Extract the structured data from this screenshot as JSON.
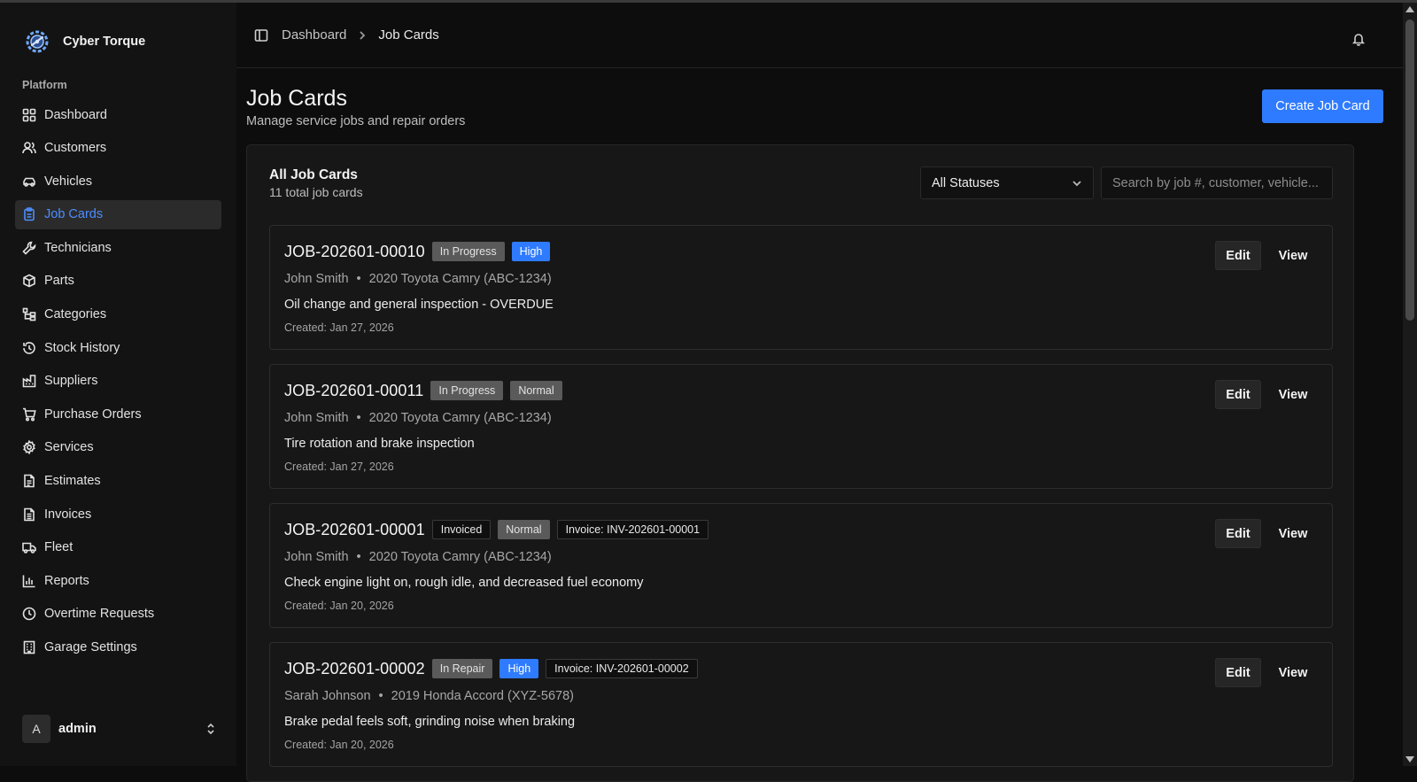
{
  "brand": {
    "name": "Cyber Torque",
    "logo_icon": "gear-logo-icon"
  },
  "sidebar": {
    "section_label": "Platform",
    "items": [
      {
        "label": "Dashboard",
        "icon": "grid-icon",
        "active": false
      },
      {
        "label": "Customers",
        "icon": "users-icon",
        "active": false
      },
      {
        "label": "Vehicles",
        "icon": "car-icon",
        "active": false
      },
      {
        "label": "Job Cards",
        "icon": "clipboard-icon",
        "active": true
      },
      {
        "label": "Technicians",
        "icon": "wrench-icon",
        "active": false
      },
      {
        "label": "Parts",
        "icon": "box-icon",
        "active": false
      },
      {
        "label": "Categories",
        "icon": "tree-icon",
        "active": false
      },
      {
        "label": "Stock History",
        "icon": "history-icon",
        "active": false
      },
      {
        "label": "Suppliers",
        "icon": "factory-icon",
        "active": false
      },
      {
        "label": "Purchase Orders",
        "icon": "cart-icon",
        "active": false
      },
      {
        "label": "Services",
        "icon": "cog-icon",
        "active": false
      },
      {
        "label": "Estimates",
        "icon": "calculator-icon",
        "active": false
      },
      {
        "label": "Invoices",
        "icon": "receipt-icon",
        "active": false
      },
      {
        "label": "Fleet",
        "icon": "truck-icon",
        "active": false
      },
      {
        "label": "Reports",
        "icon": "bar-chart-icon",
        "active": false
      },
      {
        "label": "Overtime Requests",
        "icon": "clock-icon",
        "active": false
      },
      {
        "label": "Garage Settings",
        "icon": "building-icon",
        "active": false
      }
    ],
    "user": {
      "initial": "A",
      "name": "admin"
    }
  },
  "header": {
    "breadcrumb": [
      "Dashboard",
      "Job Cards"
    ]
  },
  "page": {
    "title": "Job Cards",
    "subtitle": "Manage service jobs and repair orders",
    "create_button": "Create Job Card"
  },
  "list": {
    "title": "All Job Cards",
    "count_text": "11 total job cards",
    "status_filter": "All Statuses",
    "search_placeholder": "Search by job #, customer, vehicle...",
    "edit_label": "Edit",
    "view_label": "View",
    "cards": [
      {
        "job_number": "JOB-202601-00010",
        "badges": [
          {
            "text": "In Progress",
            "style": "grey"
          },
          {
            "text": "High",
            "style": "blue"
          }
        ],
        "customer": "John Smith",
        "vehicle": "2020 Toyota Camry (ABC-1234)",
        "description": "Oil change and general inspection - OVERDUE",
        "created": "Created: Jan 27, 2026"
      },
      {
        "job_number": "JOB-202601-00011",
        "badges": [
          {
            "text": "In Progress",
            "style": "grey"
          },
          {
            "text": "Normal",
            "style": "grey"
          }
        ],
        "customer": "John Smith",
        "vehicle": "2020 Toyota Camry (ABC-1234)",
        "description": "Tire rotation and brake inspection",
        "created": "Created: Jan 27, 2026"
      },
      {
        "job_number": "JOB-202601-00001",
        "badges": [
          {
            "text": "Invoiced",
            "style": "outline"
          },
          {
            "text": "Normal",
            "style": "grey"
          },
          {
            "text": "Invoice: INV-202601-00001",
            "style": "outline"
          }
        ],
        "customer": "John Smith",
        "vehicle": "2020 Toyota Camry (ABC-1234)",
        "description": "Check engine light on, rough idle, and decreased fuel economy",
        "created": "Created: Jan 20, 2026"
      },
      {
        "job_number": "JOB-202601-00002",
        "badges": [
          {
            "text": "In Repair",
            "style": "grey"
          },
          {
            "text": "High",
            "style": "blue"
          },
          {
            "text": "Invoice: INV-202601-00002",
            "style": "outline"
          }
        ],
        "customer": "Sarah Johnson",
        "vehicle": "2019 Honda Accord (XYZ-5678)",
        "description": "Brake pedal feels soft, grinding noise when braking",
        "created": "Created: Jan 20, 2026"
      }
    ]
  },
  "colors": {
    "accent": "#2f7bff",
    "active_nav_text": "#4d8dff",
    "background": "#0d0d0d",
    "sidebar": "#131313",
    "badge_grey": "#5a5a5a"
  }
}
